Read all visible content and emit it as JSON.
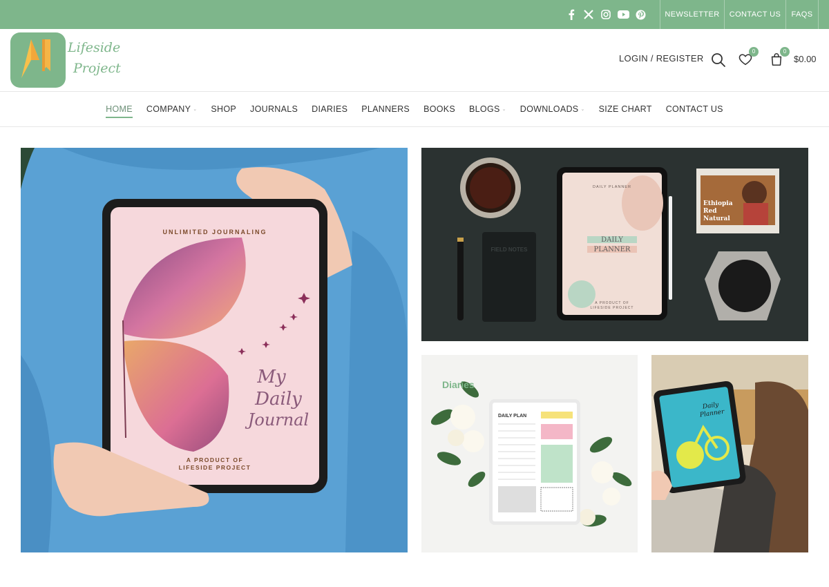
{
  "topbar": {
    "social_icons": [
      "facebook-icon",
      "x-icon",
      "instagram-icon",
      "youtube-icon",
      "pinterest-icon"
    ],
    "links": [
      "NEWSLETTER",
      "CONTACT US",
      "FAQS"
    ]
  },
  "brand": {
    "line1": "Lifeside",
    "line2": "Project"
  },
  "header": {
    "login_label": "LOGIN / REGISTER",
    "wishlist_count": "0",
    "cart_count": "0",
    "cart_total": "$0.00"
  },
  "nav": {
    "items": [
      {
        "label": "HOME",
        "active": true,
        "dropdown": false
      },
      {
        "label": "COMPANY",
        "dropdown": true
      },
      {
        "label": "SHOP",
        "dropdown": false
      },
      {
        "label": "JOURNALS",
        "dropdown": false
      },
      {
        "label": "DIARIES",
        "dropdown": false
      },
      {
        "label": "PLANNERS",
        "dropdown": false
      },
      {
        "label": "BOOKS",
        "dropdown": false
      },
      {
        "label": "BLOGS",
        "dropdown": true
      },
      {
        "label": "DOWNLOADS",
        "dropdown": true
      },
      {
        "label": "SIZE CHART",
        "dropdown": false
      },
      {
        "label": "CONTACT US",
        "dropdown": false
      }
    ]
  },
  "hero": {
    "journal": {
      "top": "UNLIMITED JOURNALING",
      "title1": "My",
      "title2": "Daily",
      "title3": "Journal",
      "bottom1": "A PRODUCT OF",
      "bottom2": "LIFESIDE PROJECT"
    },
    "planner": {
      "label": "DAILY PLANNER",
      "title1": "DAILY",
      "title2": "PLANNER",
      "bottom1": "A PRODUCT OF",
      "bottom2": "LIFESIDE PROJECT",
      "bag1": "Ethiopia",
      "bag2": "Red",
      "bag3": "Natural",
      "notebook": "FIELD NOTES"
    },
    "diaries": {
      "label": "Diaries",
      "title": "DAILY PLAN"
    },
    "tablet": {
      "title1": "Daily",
      "title2": "Planner"
    }
  },
  "colors": {
    "brand_green": "#7eb68b",
    "text": "#333333"
  }
}
